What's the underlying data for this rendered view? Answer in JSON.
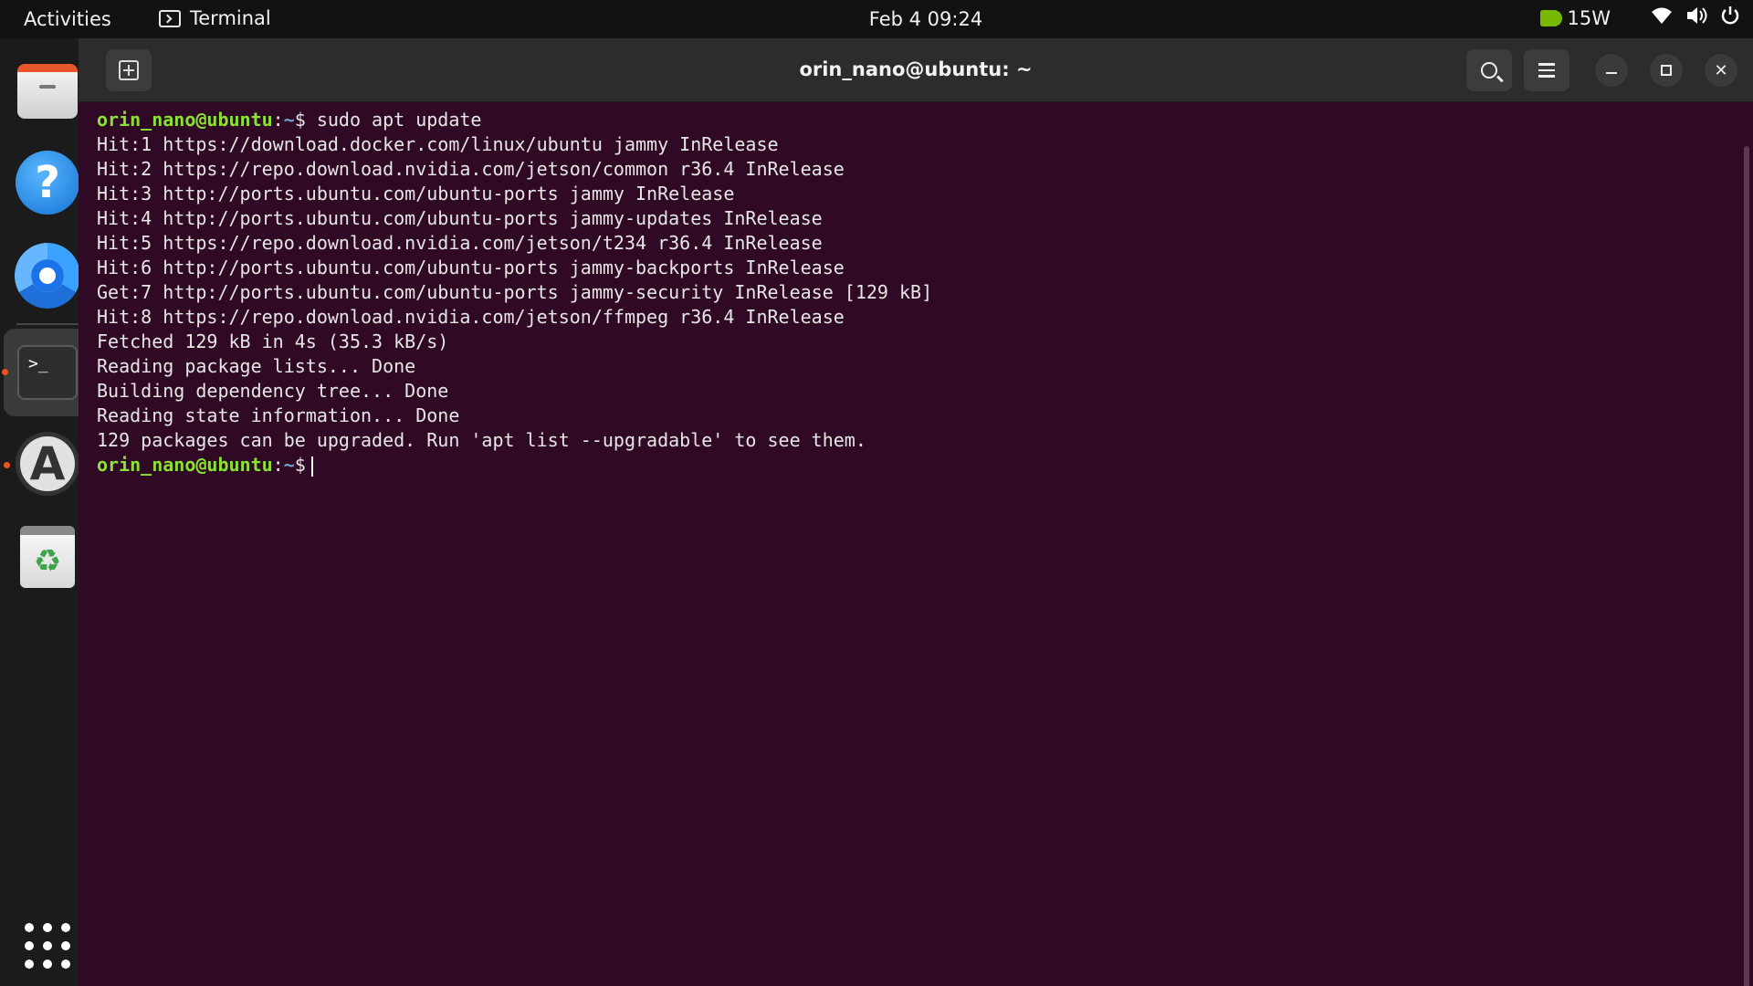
{
  "topbar": {
    "activities": "Activities",
    "app_name": "Terminal",
    "clock": "Feb 4  09:24",
    "power_mode": "15W",
    "icons": [
      "nvidia-icon",
      "wifi-icon",
      "volume-icon",
      "power-icon"
    ]
  },
  "dock": {
    "items": [
      "files-icon",
      "help-icon",
      "chromium-icon",
      "terminal-icon",
      "software-updater-icon",
      "trash-icon",
      "show-apps-icon"
    ],
    "running_indicator_color": "#e95420"
  },
  "window": {
    "title": "orin_nano@ubuntu: ~"
  },
  "terminal": {
    "colors": {
      "background": "#300a24",
      "prompt": "#8ae234",
      "path": "#729fcf",
      "text": "#e6e6e6"
    },
    "prompt_user": "orin_nano@ubuntu",
    "prompt_sep": ":",
    "prompt_path": "~",
    "prompt_symbol": "$",
    "command": " sudo apt update",
    "output": [
      "Hit:1 https://download.docker.com/linux/ubuntu jammy InRelease",
      "Hit:2 https://repo.download.nvidia.com/jetson/common r36.4 InRelease",
      "Hit:3 http://ports.ubuntu.com/ubuntu-ports jammy InRelease",
      "Hit:4 http://ports.ubuntu.com/ubuntu-ports jammy-updates InRelease",
      "Hit:5 https://repo.download.nvidia.com/jetson/t234 r36.4 InRelease",
      "Hit:6 http://ports.ubuntu.com/ubuntu-ports jammy-backports InRelease",
      "Get:7 http://ports.ubuntu.com/ubuntu-ports jammy-security InRelease [129 kB]",
      "Hit:8 https://repo.download.nvidia.com/jetson/ffmpeg r36.4 InRelease",
      "Fetched 129 kB in 4s (35.3 kB/s)",
      "Reading package lists... Done",
      "Building dependency tree... Done",
      "Reading state information... Done",
      "129 packages can be upgraded. Run 'apt list --upgradable' to see them."
    ]
  }
}
